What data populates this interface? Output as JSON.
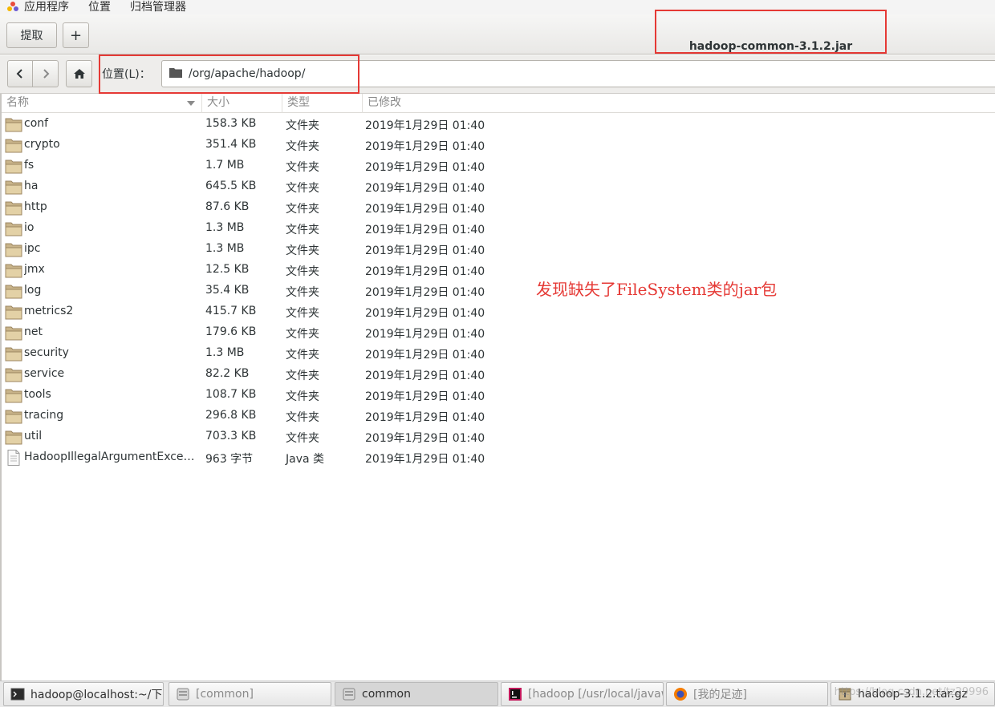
{
  "menubar": {
    "items": [
      "应用程序",
      "位置",
      "归档管理器"
    ]
  },
  "toolbar": {
    "extract_label": "提取",
    "add_label": "+",
    "title": "hadoop-common-3.1.2.jar"
  },
  "location": {
    "label": "位置(L)：",
    "path": "/org/apache/hadoop/"
  },
  "columns": {
    "name": "名称",
    "size": "大小",
    "type": "类型",
    "modified": "已修改"
  },
  "rows": [
    {
      "name": "conf",
      "size": "158.3 KB",
      "type": "文件夹",
      "modified": "2019年1月29日  01:40",
      "icon": "folder-icon"
    },
    {
      "name": "crypto",
      "size": "351.4 KB",
      "type": "文件夹",
      "modified": "2019年1月29日  01:40",
      "icon": "folder-icon"
    },
    {
      "name": "fs",
      "size": "1.7 MB",
      "type": "文件夹",
      "modified": "2019年1月29日  01:40",
      "icon": "folder-icon"
    },
    {
      "name": "ha",
      "size": "645.5 KB",
      "type": "文件夹",
      "modified": "2019年1月29日  01:40",
      "icon": "folder-icon"
    },
    {
      "name": "http",
      "size": "87.6 KB",
      "type": "文件夹",
      "modified": "2019年1月29日  01:40",
      "icon": "folder-icon"
    },
    {
      "name": "io",
      "size": "1.3 MB",
      "type": "文件夹",
      "modified": "2019年1月29日  01:40",
      "icon": "folder-icon"
    },
    {
      "name": "ipc",
      "size": "1.3 MB",
      "type": "文件夹",
      "modified": "2019年1月29日  01:40",
      "icon": "folder-icon"
    },
    {
      "name": "jmx",
      "size": "12.5 KB",
      "type": "文件夹",
      "modified": "2019年1月29日  01:40",
      "icon": "folder-icon"
    },
    {
      "name": "log",
      "size": "35.4 KB",
      "type": "文件夹",
      "modified": "2019年1月29日  01:40",
      "icon": "folder-icon"
    },
    {
      "name": "metrics2",
      "size": "415.7 KB",
      "type": "文件夹",
      "modified": "2019年1月29日  01:40",
      "icon": "folder-icon"
    },
    {
      "name": "net",
      "size": "179.6 KB",
      "type": "文件夹",
      "modified": "2019年1月29日  01:40",
      "icon": "folder-icon"
    },
    {
      "name": "security",
      "size": "1.3 MB",
      "type": "文件夹",
      "modified": "2019年1月29日  01:40",
      "icon": "folder-icon"
    },
    {
      "name": "service",
      "size": "82.2 KB",
      "type": "文件夹",
      "modified": "2019年1月29日  01:40",
      "icon": "folder-icon"
    },
    {
      "name": "tools",
      "size": "108.7 KB",
      "type": "文件夹",
      "modified": "2019年1月29日  01:40",
      "icon": "folder-icon"
    },
    {
      "name": "tracing",
      "size": "296.8 KB",
      "type": "文件夹",
      "modified": "2019年1月29日  01:40",
      "icon": "folder-icon"
    },
    {
      "name": "util",
      "size": "703.3 KB",
      "type": "文件夹",
      "modified": "2019年1月29日  01:40",
      "icon": "folder-icon"
    },
    {
      "name": "HadoopIllegalArgumentExcepti…",
      "size": "963  字节",
      "type": "Java 类",
      "modified": "2019年1月29日  01:40",
      "icon": "file-icon"
    }
  ],
  "annotation": "发现缺失了FileSystem类的jar包",
  "taskbar": {
    "items": [
      {
        "label": "hadoop@localhost:~/下载",
        "icon": "terminal-icon",
        "dim": false
      },
      {
        "label": "[common]",
        "icon": "file-manager-icon",
        "dim": true
      },
      {
        "label": "common",
        "icon": "file-manager-icon",
        "dim": false
      },
      {
        "label": "[hadoop [/usr/local/javaw-…",
        "icon": "intellij-icon",
        "dim": true
      },
      {
        "label": "[我的足迹]",
        "icon": "firefox-icon",
        "dim": true
      },
      {
        "label": "hadoop-3.1.2.tar.gz",
        "icon": "archive-icon",
        "dim": false
      }
    ],
    "watermark": "https://blog.csdn.net/tz29996"
  }
}
